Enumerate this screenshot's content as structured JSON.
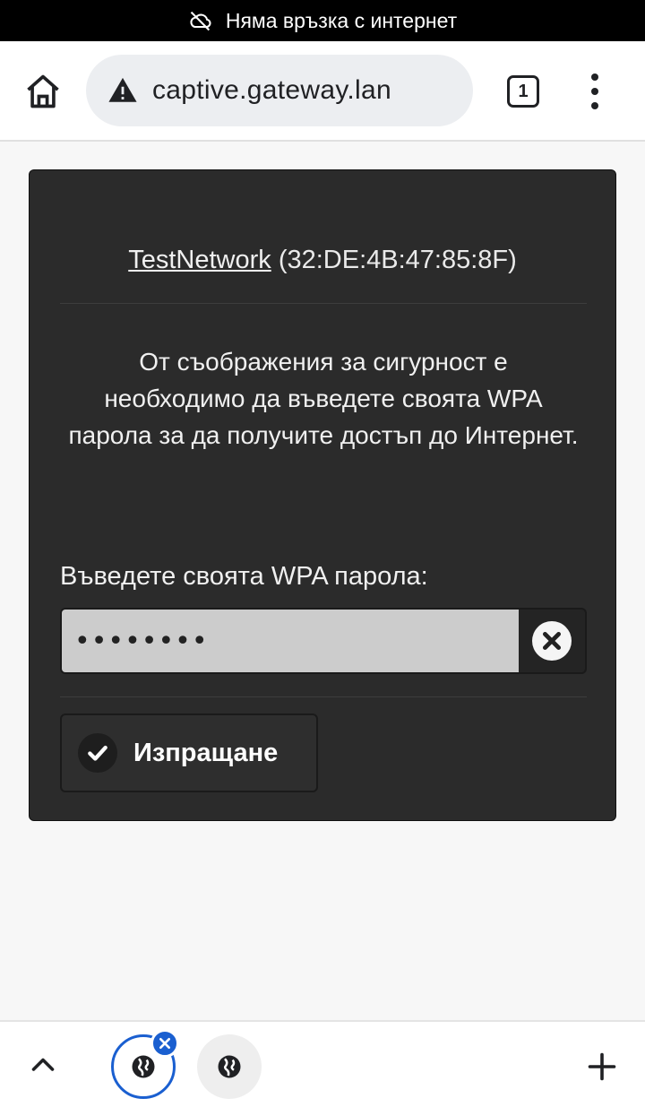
{
  "status_bar": {
    "text": "Няма връзка с интернет",
    "icon": "cloud-off-icon"
  },
  "browser": {
    "url": "captive.gateway.lan",
    "tab_count": "1",
    "icons": [
      "home-icon",
      "warning-icon",
      "tabs-icon",
      "more-vert-icon"
    ]
  },
  "card": {
    "ssid": "TestNetwork",
    "bssid": "(32:DE:4B:47:85:8F)",
    "message": "От съображения за сигурност е необходимо да въведете своята WPA парола за да получите достъп до Интернет.",
    "password_label": "Въведете своята WPA парола:",
    "password_value": "••••••••",
    "submit_label": "Изпращане"
  },
  "colors": {
    "card_bg": "#2b2b2b",
    "accent_blue": "#1a5fd0",
    "input_bg": "#cccccc"
  }
}
